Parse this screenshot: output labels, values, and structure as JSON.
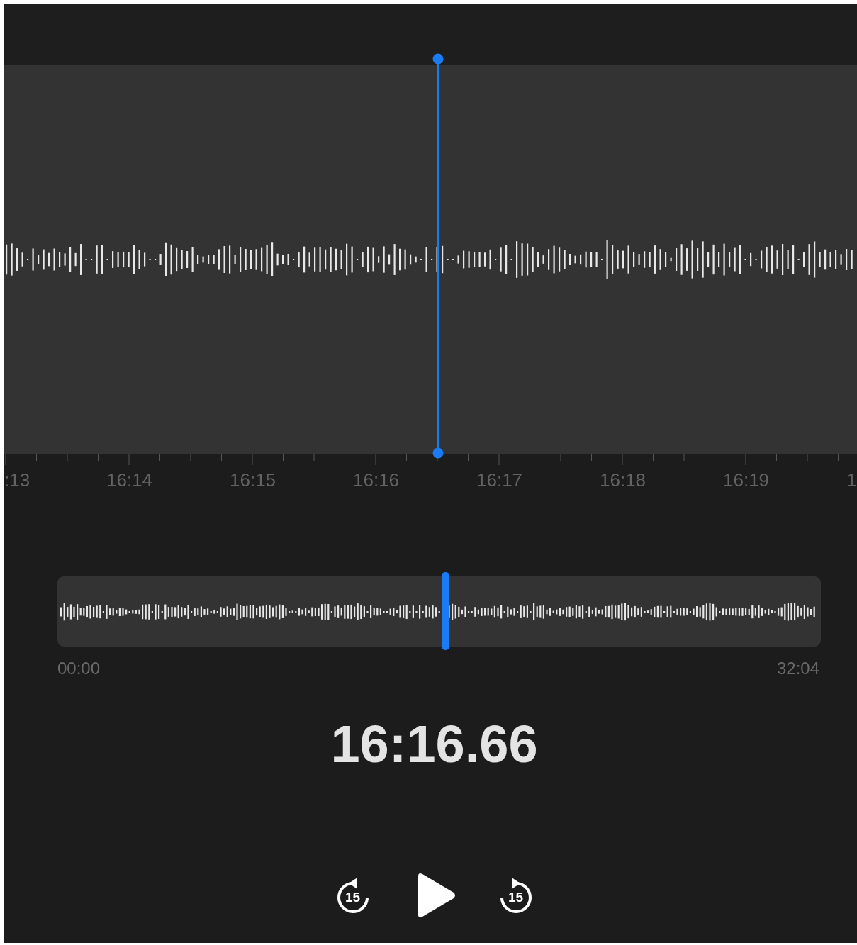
{
  "timeline": {
    "ruler_labels": [
      ":13",
      "16:14",
      "16:15",
      "16:16",
      "16:17",
      "16:18",
      "16:19",
      "1"
    ]
  },
  "overview": {
    "start": "00:00",
    "end": "32:04",
    "level": 0.508
  },
  "current_time": "16:16.66",
  "controls": [
    {
      "kind": "skip_back",
      "label": "15"
    },
    {
      "kind": "play"
    },
    {
      "kind": "skip_forward",
      "label": "15"
    }
  ]
}
